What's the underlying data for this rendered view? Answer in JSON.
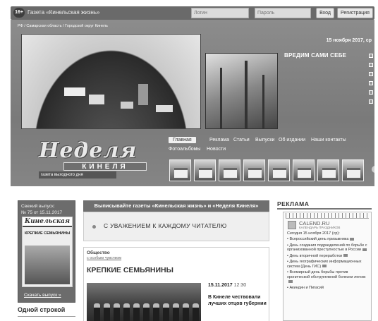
{
  "topbar": {
    "age_badge": "16+",
    "site_name": "Газета «Кинельская жизнь»",
    "login_placeholder": "Логин",
    "password_placeholder": "Пароль",
    "login_button": "Вход",
    "register_button": "Регистрация"
  },
  "header": {
    "breadcrumb": "РФ / Самарская область / Городской округ Кинель",
    "date": "15 ноября 2017, ср",
    "headline": "ВРЕДИМ САМИ СЕБЕ",
    "slider_dot_count": 6
  },
  "logo": {
    "script": "Неделя",
    "name": "КИНЕЛЯ",
    "tagline": "газета выходного дня"
  },
  "nav": {
    "items": [
      "Главная",
      "Реклама",
      "Статьи",
      "Выпуски",
      "Об издании",
      "Наши контакты",
      "Фотоальбомы",
      "Новости"
    ],
    "active": "Главная"
  },
  "fresh_issue": {
    "label": "Свежий выпуск:",
    "number": "№ 75 от 15.11.2017",
    "cover_masthead": "Кинельская",
    "cover_title": "КРЕПКИЕ СЕМЬЯНИНЫ",
    "download": "Скачать выпуск »"
  },
  "one_line": "Одной строкой",
  "subscribe_banner": "Выписывайте газеты «Кинельская жизнь» и «Неделя Кинеля»",
  "respect": "С УВАЖЕНИЕМ К КАЖДОМУ ЧИТАТЕЛЮ",
  "article": {
    "category": "Общество",
    "tag": "с особым чувством",
    "title": "КРЕПКИЕ СЕМЬЯНИНЫ",
    "date": "15.11.2017",
    "time": "12:30",
    "lead": "В Кинеле чествовали лучших отцов губернии"
  },
  "ads": {
    "heading": "РЕКЛАМА",
    "calendar_name": "CALEND.RU",
    "calendar_sub": "КАЛЕНДАРЬ ПРАЗДНИКОВ",
    "calendar_date": "Сегодня 15 ноября 2017 (ср):",
    "events": [
      "• Всероссийский день призывника",
      "• День создания подразделений по борьбе с организованной преступностью в России",
      "• День вторичной переработки",
      "• День географических информационных систем (День ГИС)",
      "• Всемирный день борьбы против хронической обструктивной болезни легких",
      "• Акиндин и Пигасий"
    ]
  }
}
